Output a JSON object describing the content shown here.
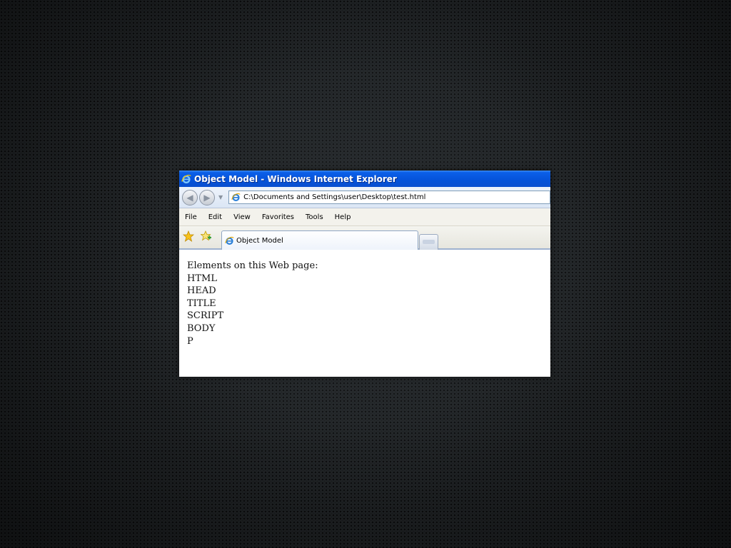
{
  "window": {
    "title": "Object Model - Windows Internet Explorer"
  },
  "address_bar": {
    "url": "C:\\Documents and Settings\\user\\Desktop\\test.html"
  },
  "menu": {
    "items": [
      "File",
      "Edit",
      "View",
      "Favorites",
      "Tools",
      "Help"
    ]
  },
  "tabs": [
    {
      "label": "Object Model"
    }
  ],
  "page": {
    "heading": "Elements on this Web page:",
    "elements": [
      "HTML",
      "HEAD",
      "TITLE",
      "SCRIPT",
      "BODY",
      "P"
    ]
  },
  "icons": {
    "ie_logo": "ie-logo-icon",
    "back": "back-arrow-icon",
    "forward": "forward-arrow-icon",
    "favorites": "favorites-star-icon",
    "add_favorites": "add-favorites-icon"
  },
  "colors": {
    "titlebar": "#0552d9",
    "background": "#1c1f21"
  }
}
